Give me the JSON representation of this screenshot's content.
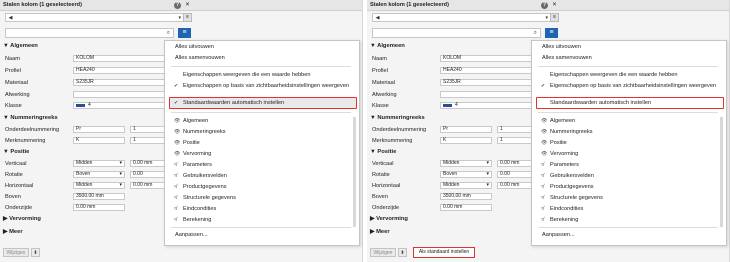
{
  "panel": {
    "title": "Stalen kolom (1 geselecteerd)",
    "help_icon": "?",
    "close_icon": "×",
    "select_prev_icon": "◀",
    "select_caret": "▾",
    "select_btn_icon": "≡",
    "search_icon": "⌕",
    "menu_icon": "≡",
    "sections": {
      "algemeen": "▼ Algemeen",
      "nummeringreeks": "▼ Nummeringreeks",
      "positie": "▼ Positie",
      "vervorming": "▶ Vervorming",
      "meer": "▶ Meer"
    },
    "fields": {
      "naam_label": "Naam",
      "naam_value": "KOLOM",
      "profiel_label": "Profiel",
      "profiel_value": "HEA240",
      "materiaal_label": "Materiaal",
      "materiaal_value": "S235JR",
      "afwerking_label": "Afwerking",
      "afwerking_value": "",
      "klasse_label": "Klasse",
      "klasse_value": "4",
      "onderdeel_label": "Onderdeelnummering",
      "onderdeel_prefix": "Pr",
      "onderdeel_num": "1",
      "merk_label": "Merknummering",
      "merk_prefix": "K",
      "merk_num": "1",
      "verticaal_label": "Verticaal",
      "verticaal_value": "Midden",
      "verticaal_offset": "0.00 mm",
      "rotatie_label": "Rotatie",
      "rotatie_value": "Boven",
      "rotatie_offset": "0.00",
      "horizontaal_label": "Horizontaal",
      "horizontaal_value": "Midden",
      "horizontaal_offset": "0.00 mm",
      "boven_label": "Boven",
      "boven_value": "3500.00 mm",
      "onderzijde_label": "Onderzijde",
      "onderzijde_value": "0.00 mm"
    },
    "bottom": {
      "apply": "Wijzigen",
      "pin_icon": "⬍",
      "std_button": "Als standaard instellen"
    }
  },
  "menu": {
    "expand_all": "Alles uitvouwen",
    "collapse_all": "Alles samenvouwen",
    "show_with_value": "Eigenschappen weergeven die een waarde hebben",
    "show_by_visibility": "Eigenschappen op basis van zichtbaarheidsinstellingen weergeven",
    "auto_defaults": "Standaardwaarden automatisch instellen",
    "check_icon": "✔",
    "eye_icon": "👁",
    "hidden_icon": "≉",
    "items": [
      "Algemeen",
      "Nummeringreeks",
      "Positie",
      "Vervorming",
      "Parameters",
      "Gebruikersvelden",
      "Productgegevens",
      "Structurele gegevens",
      "Eindcondities",
      "Berekening"
    ],
    "customize": "Aanpassen..."
  },
  "colors": {
    "accent": "#1f64b0",
    "highlight": "#e0322e",
    "class_color": "#2b4d93"
  }
}
